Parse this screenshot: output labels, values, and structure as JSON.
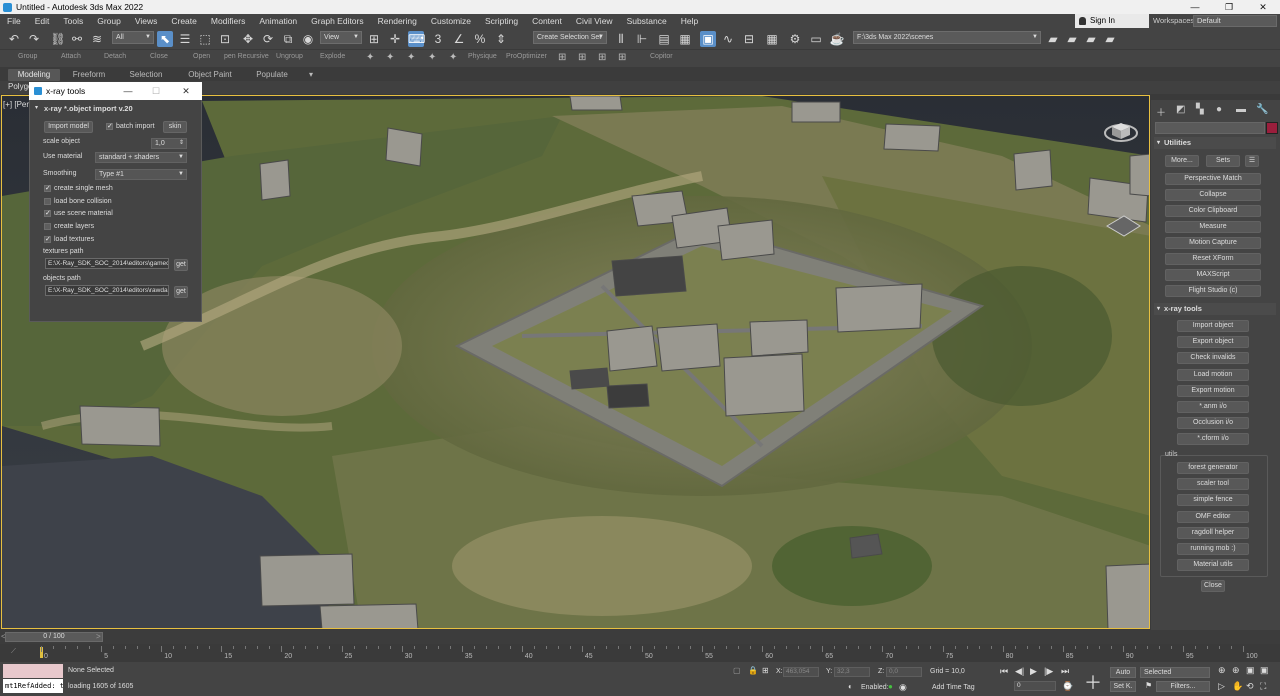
{
  "window": {
    "title": "Untitled - Autodesk 3ds Max 2022",
    "minimize": "—",
    "maximize": "❐",
    "close": "✕"
  },
  "menu": [
    "File",
    "Edit",
    "Tools",
    "Group",
    "Views",
    "Create",
    "Modifiers",
    "Animation",
    "Graph Editors",
    "Rendering",
    "Customize",
    "Scripting",
    "Content",
    "Civil View",
    "Substance",
    "Help"
  ],
  "account": {
    "sign_in": "Sign In",
    "workspaces_label": "Workspaces:",
    "workspace": "Default"
  },
  "toolbar": {
    "selection_filter": "All",
    "ref_coord": "View",
    "named_selection": "Create Selection Set",
    "project_path": "F:\\3ds Max 2022\\scenes",
    "icons": [
      "undo-icon",
      "redo-icon",
      "link-icon",
      "unlink-icon",
      "bind-space-warp-icon",
      "select-object-icon",
      "select-by-name-icon",
      "rect-region-icon",
      "window-crossing-icon",
      "move-icon",
      "rotate-icon",
      "scale-icon",
      "place-icon",
      "pivot-icon",
      "select-manipulate-icon",
      "keyboard-shortcut-icon",
      "snaps-toggle-icon",
      "angle-snap-icon",
      "percent-snap-icon",
      "spinner-snap-icon",
      "mirror-icon",
      "align-icon",
      "layer-explorer-icon",
      "scene-explorer-icon",
      "ribbon-toggle-icon",
      "curve-editor-icon",
      "schematic-view-icon",
      "material-editor-icon",
      "render-setup-icon",
      "render-frame-icon",
      "render-icon"
    ]
  },
  "toolbar2": {
    "labels": [
      "Group",
      "Attach",
      "Detach",
      "Close",
      "Open",
      "pen Recursive",
      "Ungroup",
      "Explode",
      "Physique",
      "ProOptimizer",
      "Copitor"
    ]
  },
  "ribbon": {
    "tabs": [
      "Modeling",
      "Freeform",
      "Selection",
      "Object Paint",
      "Populate"
    ],
    "active_tab": "Modeling",
    "sub": "Polygo"
  },
  "viewport": {
    "label": "[+] [Per",
    "scene": "terrain-with-settlement"
  },
  "dialog": {
    "title": "x-ray tools",
    "header": "x-ray *.object import v.20",
    "import_button": "Import model",
    "batch_import": {
      "label": "batch import",
      "checked": true
    },
    "skin_button": "skin",
    "scale_label": "scale object",
    "scale_value": "1,0",
    "use_material_label": "Use material",
    "use_material_value": "standard + shaders",
    "smoothing_label": "Smoothing",
    "smoothing_value": "Type #1",
    "options": [
      {
        "label": "create single mesh",
        "checked": true
      },
      {
        "label": "load bone collision",
        "checked": false
      },
      {
        "label": "use scene material",
        "checked": true
      },
      {
        "label": "create layers",
        "checked": false
      },
      {
        "label": "load textures",
        "checked": true
      }
    ],
    "textures_path_label": "textures path",
    "textures_path": "E:\\X-Ray_SDK_SOC_2014\\editors\\gamec",
    "objects_path_label": "objects path",
    "objects_path": "E:\\X-Ray_SDK_SOC_2014\\editors\\rawda",
    "get_label": "get"
  },
  "command_panel": {
    "utilities_title": "Utilities",
    "more_button": "More...",
    "sets_button": "Sets",
    "utilities": [
      "Perspective Match",
      "Collapse",
      "Color Clipboard",
      "Measure",
      "Motion Capture",
      "Reset XForm",
      "MAXScript",
      "Flight Studio (c)"
    ],
    "xray_title": "x-ray tools",
    "xray_buttons": [
      "Import object",
      "Export object",
      "Check invalids",
      "Load motion",
      "Export motion",
      "*.anm i/o",
      "Occlusion i/o",
      "*.cform i/o"
    ],
    "utils_label": "utils",
    "utils_buttons": [
      "forest generator",
      "scaler tool",
      "simple fence",
      "OMF editor",
      "ragdoll helper",
      "running mob :)",
      "Material utils"
    ],
    "close_button": "Close",
    "accent_color": "#9a1e3c"
  },
  "timeline": {
    "slider": "0 / 100",
    "current_frame": 0,
    "ticks": [
      "0",
      "5",
      "10",
      "15",
      "20",
      "25",
      "30",
      "35",
      "40",
      "45",
      "50",
      "55",
      "60",
      "65",
      "70",
      "75",
      "80",
      "85",
      "90",
      "95",
      "100"
    ]
  },
  "status": {
    "maxscript_text": "mt1RefAdded: t",
    "selection": "None Selected",
    "prompt": "loading 1605 of 1605",
    "x_label": "X:",
    "x_value": "463,054",
    "y_label": "Y:",
    "y_value": "32,3",
    "z_label": "Z:",
    "z_value": "0,0",
    "grid": "Grid = 10,0",
    "enabled_label": "Enabled:",
    "add_time_tag": "Add Time Tag",
    "auto_button": "Auto",
    "set_key_button": "Set K.",
    "key_mode": "Selected",
    "filters_button": "Filters...",
    "frame_field": "0"
  }
}
